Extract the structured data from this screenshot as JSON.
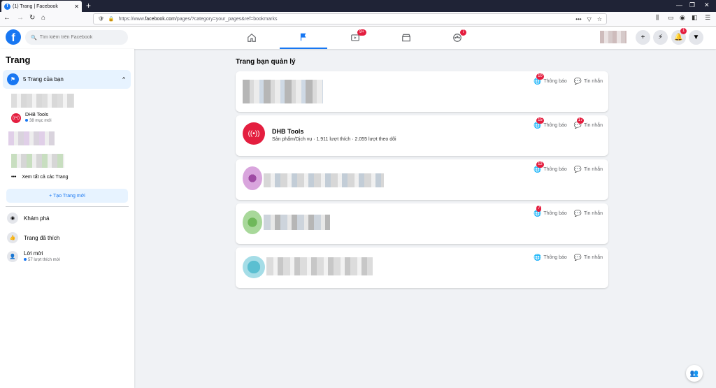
{
  "browser": {
    "tab_title": "(1) Trang | Facebook",
    "url_prefix": "https://www.",
    "url_host": "facebook.com",
    "url_path": "/pages/?category=your_pages&ref=bookmarks"
  },
  "header": {
    "search_placeholder": "Tìm kiếm trên Facebook",
    "nav": [
      {
        "name": "home-icon",
        "badge": ""
      },
      {
        "name": "flag-icon",
        "badge": ""
      },
      {
        "name": "watch-icon",
        "badge": "9+"
      },
      {
        "name": "marketplace-icon",
        "badge": ""
      },
      {
        "name": "groups-icon",
        "badge": "7"
      }
    ],
    "notifications_badge": "1"
  },
  "sidebar": {
    "title": "Trang",
    "my_pages_label": "5 Trang của bạn",
    "dhb_name": "DHB Tools",
    "dhb_sub": "38 mục mới",
    "see_all": "Xem tất cả các Trang",
    "create": "+ Tạo Trang mới",
    "nav": [
      {
        "label": "Khám phá",
        "sub": ""
      },
      {
        "label": "Trang đã thích",
        "sub": ""
      },
      {
        "label": "Lời mời",
        "sub": "57 lượt thích mới"
      }
    ]
  },
  "main": {
    "title": "Trang bạn quản lý",
    "notif_label": "Thông báo",
    "msg_label": "Tin nhắn",
    "cards": [
      {
        "notif_badge": "10",
        "msg_badge": ""
      },
      {
        "notif_badge": "15",
        "msg_badge": "17",
        "name": "DHB Tools",
        "sub": "Sản phẩm/Dịch vụ · 1.911 lượt thích · 2.055 lượt theo dõi"
      },
      {
        "notif_badge": "12",
        "msg_badge": ""
      },
      {
        "notif_badge": "7",
        "msg_badge": ""
      },
      {
        "notif_badge": "",
        "msg_badge": ""
      }
    ]
  },
  "colors": {
    "brand": "#1877f2",
    "badge": "#e41e3f"
  }
}
